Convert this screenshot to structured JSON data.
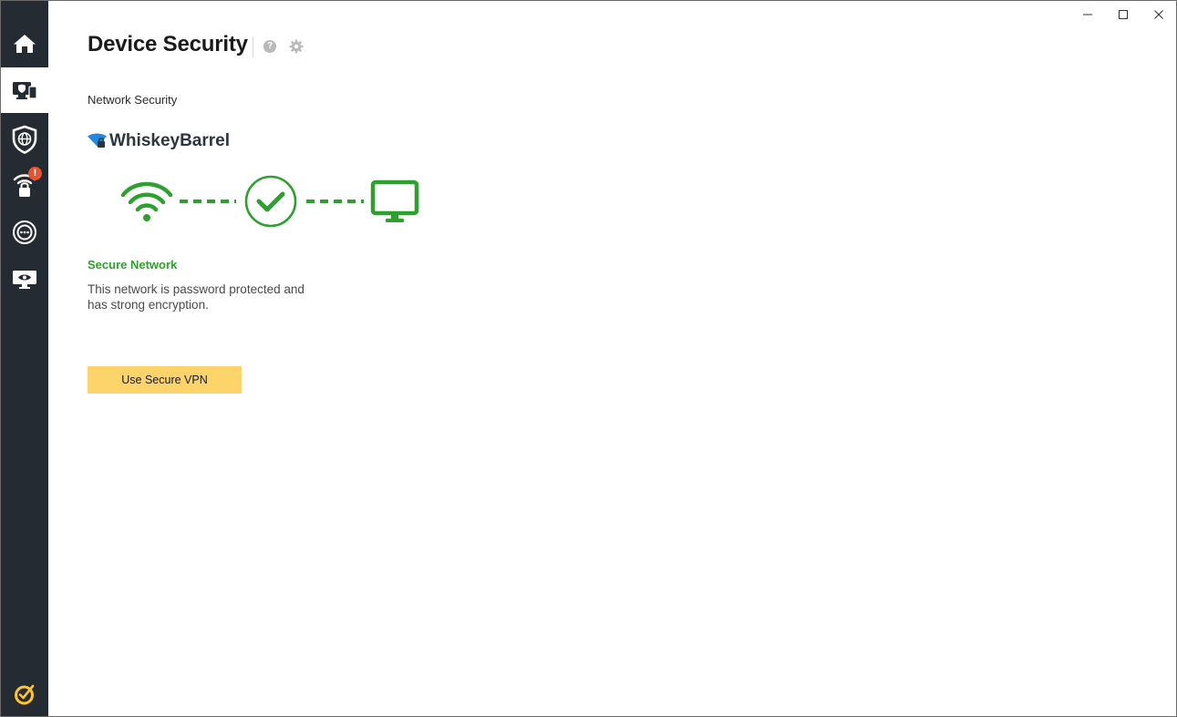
{
  "window": {
    "controls": {
      "minimize_icon": "minimize-icon",
      "maximize_icon": "maximize-icon",
      "close_icon": "close-icon"
    }
  },
  "sidebar": {
    "items": [
      {
        "id": "home",
        "icon": "home-icon",
        "active": false
      },
      {
        "id": "device-security",
        "icon": "device-shield-icon",
        "active": true
      },
      {
        "id": "online-privacy",
        "icon": "globe-shield-icon",
        "active": false
      },
      {
        "id": "network-security",
        "icon": "wifi-lock-icon",
        "active": false,
        "badge": "!"
      },
      {
        "id": "chat",
        "icon": "chat-icon",
        "active": false
      },
      {
        "id": "privacy-monitor",
        "icon": "eye-monitor-icon",
        "active": false
      }
    ],
    "brand_icon": "norton-logo-icon"
  },
  "header": {
    "title": "Device Security",
    "help_glyph": "?",
    "help_icon": "help-icon",
    "settings_icon": "gear-icon"
  },
  "main": {
    "section_label": "Network Security",
    "network_name": "WhiskeyBarrel",
    "status_title": "Secure Network",
    "status_description": "This network is password protected and has strong encryption.",
    "vpn_button_label": "Use Secure VPN"
  },
  "colors": {
    "sidebar_bg": "#252b32",
    "secure_green": "#2ea02e",
    "vpn_button": "#fdd46a",
    "badge": "#e8522d",
    "wifi_blue": "#1e88e5",
    "brand_yellow": "#ffc629"
  }
}
